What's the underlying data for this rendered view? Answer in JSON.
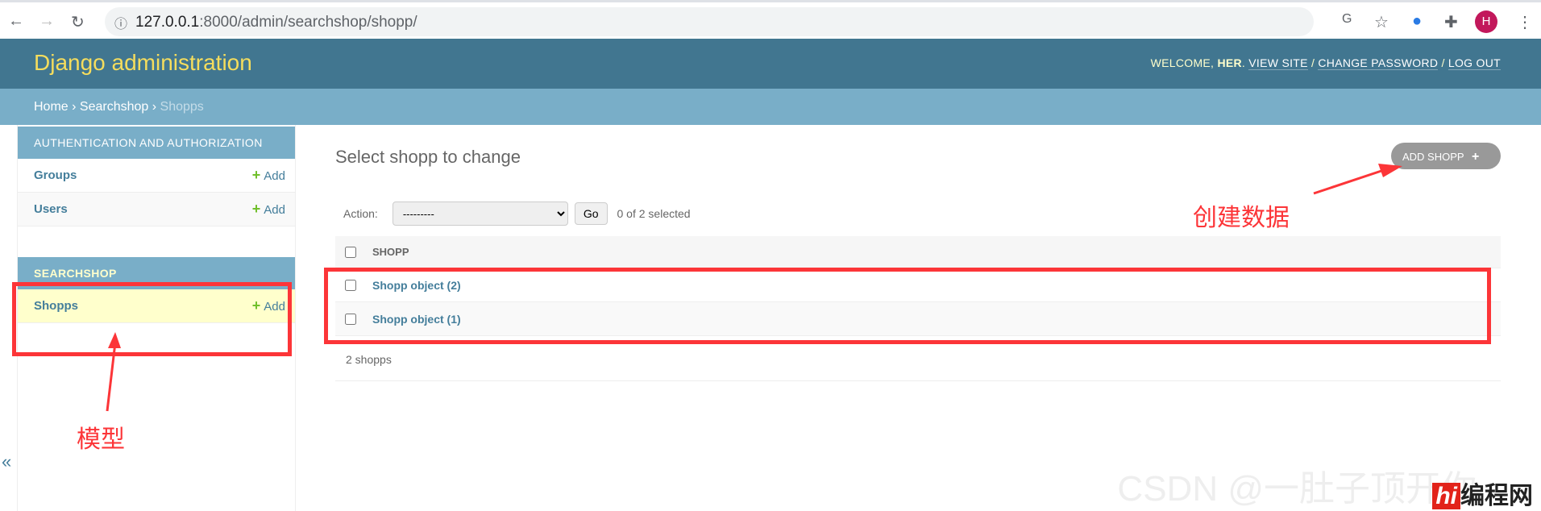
{
  "browser": {
    "url_host": "127.0.0.1",
    "url_rest": ":8000/admin/searchshop/shopp/",
    "avatar": "H"
  },
  "header": {
    "brand": "Django administration",
    "welcome": "WELCOME, ",
    "user": "HER",
    "view_site": "VIEW SITE",
    "change_password": "CHANGE PASSWORD",
    "log_out": "LOG OUT"
  },
  "breadcrumb": {
    "home": "Home",
    "app": "Searchshop",
    "current": "Shopps"
  },
  "sidebar": {
    "modules": [
      {
        "caption": "AUTHENTICATION AND AUTHORIZATION",
        "models": [
          {
            "name": "Groups",
            "add": "Add"
          },
          {
            "name": "Users",
            "add": "Add"
          }
        ]
      },
      {
        "caption": "SEARCHSHOP",
        "models": [
          {
            "name": "Shopps",
            "add": "Add"
          }
        ]
      }
    ],
    "collapse": "«"
  },
  "main": {
    "title": "Select shopp to change",
    "add_button": "ADD SHOPP",
    "action_label": "Action:",
    "action_value": "---------",
    "go": "Go",
    "selected": "0 of 2 selected",
    "column": "SHOPP",
    "rows": [
      "Shopp object (2)",
      "Shopp object (1)"
    ],
    "count": "2 shopps"
  },
  "annotations": {
    "model": "模型",
    "create": "创建数据"
  },
  "watermark": {
    "csdn": "CSDN @一肚子顶开你",
    "logo_mark": "hi",
    "logo_text": "编程网"
  },
  "colors": {
    "header": "#417690",
    "breadcrumb": "#79aec8",
    "brand": "#f5dd5d",
    "annotation": "#fc3538",
    "link": "#447e9b",
    "add_plus": "#70bf2b"
  }
}
